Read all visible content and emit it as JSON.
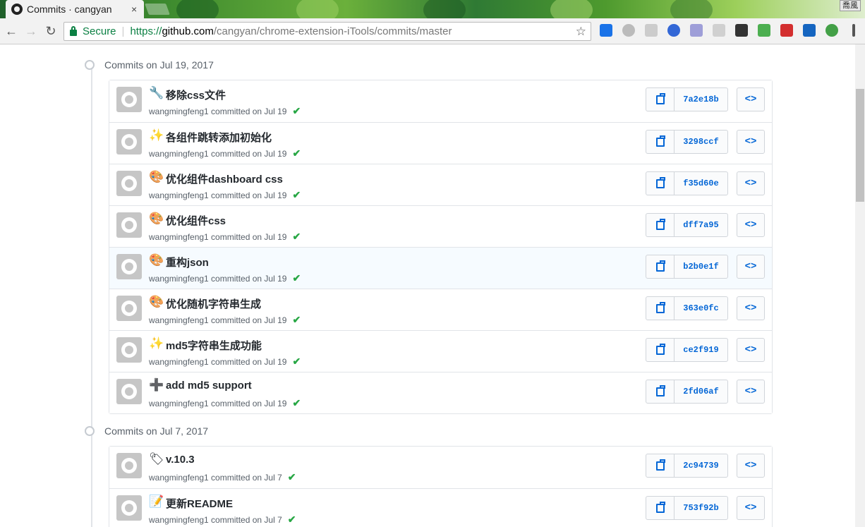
{
  "browser": {
    "tab_title": "Commits · cangyan",
    "tab_close": "×",
    "window_button": "喬風",
    "back_icon": "arrow-left-icon",
    "forward_icon": "arrow-right-icon",
    "reload_icon": "reload-icon",
    "secure_label": "Secure",
    "url_scheme": "https://",
    "url_host": "github.com",
    "url_path": "/cangyan/chrome-extension-iTools/commits/master",
    "extensions": [
      {
        "name": "new-extension-icon",
        "color": "#1a73e8"
      },
      {
        "name": "circle-extension-icon",
        "color": "#bbbbbb"
      },
      {
        "name": "gray-extension-icon",
        "color": "#cccccc"
      },
      {
        "name": "globe-extension-icon",
        "color": "#3367d6"
      },
      {
        "name": "react-extension-icon",
        "color": "#9e9ed8"
      },
      {
        "name": "es-extension-icon",
        "color": "#d0d0d0"
      },
      {
        "name": "eyedropper-extension-icon",
        "color": "#333333"
      },
      {
        "name": "leaf-extension-icon",
        "color": "#4caf50"
      },
      {
        "name": "red-extension-icon",
        "color": "#d32f2f"
      },
      {
        "name": "qr-extension-icon",
        "color": "#1565c0"
      },
      {
        "name": "check-extension-icon",
        "color": "#43a047"
      },
      {
        "name": "menu-icon",
        "color": "#555555"
      }
    ]
  },
  "groups": [
    {
      "heading": "Commits on Jul 19, 2017",
      "commits": [
        {
          "emoji": "🔧",
          "emoji_name": "wrench-icon",
          "message": "移除css文件",
          "meta": "wangmingfeng1 committed on Jul 19",
          "sha": "7a2e18b"
        },
        {
          "emoji": "✨",
          "emoji_name": "sparkles-icon",
          "message": "各组件跳转添加初始化",
          "meta": "wangmingfeng1 committed on Jul 19",
          "sha": "3298ccf"
        },
        {
          "emoji": "🎨",
          "emoji_name": "palette-icon",
          "message": "优化组件dashboard css",
          "meta": "wangmingfeng1 committed on Jul 19",
          "sha": "f35d60e"
        },
        {
          "emoji": "🎨",
          "emoji_name": "palette-icon",
          "message": "优化组件css",
          "meta": "wangmingfeng1 committed on Jul 19",
          "sha": "dff7a95"
        },
        {
          "emoji": "🎨",
          "emoji_name": "palette-icon",
          "message": "重构json",
          "meta": "wangmingfeng1 committed on Jul 19",
          "sha": "b2b0e1f",
          "highlight": true
        },
        {
          "emoji": "🎨",
          "emoji_name": "palette-icon",
          "message": "优化随机字符串生成",
          "meta": "wangmingfeng1 committed on Jul 19",
          "sha": "363e0fc"
        },
        {
          "emoji": "✨",
          "emoji_name": "sparkles-icon",
          "message": "md5字符串生成功能",
          "meta": "wangmingfeng1 committed on Jul 19",
          "sha": "ce2f919"
        },
        {
          "emoji": "➕",
          "emoji_name": "plus-icon",
          "message": "add md5 support",
          "meta": "wangmingfeng1 committed on Jul 19",
          "sha": "2fd06af"
        }
      ]
    },
    {
      "heading": "Commits on Jul 7, 2017",
      "commits": [
        {
          "emoji": "🏷",
          "emoji_name": "tag-icon",
          "message": "v.10.3",
          "meta": "wangmingfeng1 committed on Jul 7",
          "sha": "2c94739"
        },
        {
          "emoji": "📝",
          "emoji_name": "memo-icon",
          "message": "更新README",
          "meta": "wangmingfeng1 committed on Jul 7",
          "sha": "753f92b"
        }
      ]
    }
  ],
  "browse_label": "<>",
  "check_mark": "✔",
  "colors": {
    "link": "#0366d6",
    "success": "#28a745",
    "secure": "#0b8043",
    "border": "#e1e4e8"
  }
}
